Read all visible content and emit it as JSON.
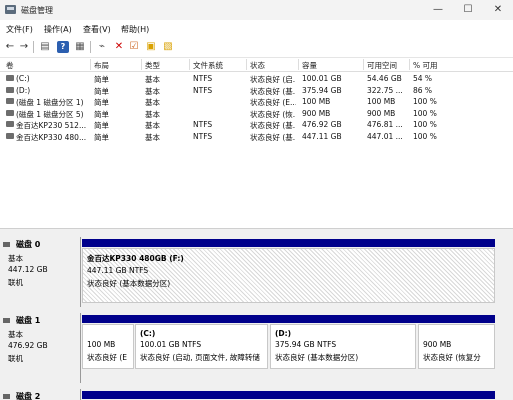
{
  "window": {
    "title": "磁盘管理",
    "min": "—",
    "max": "☐",
    "close": "✕"
  },
  "menu": [
    "文件(F)",
    "操作(A)",
    "查看(V)",
    "帮助(H)"
  ],
  "toolbar": {
    "icons": [
      "back-arrow-icon",
      "forward-arrow-icon",
      "list-view-icon",
      "help-icon",
      "properties-icon",
      "connect-icon",
      "delete-icon",
      "checkmark-icon",
      "new-icon",
      "folder-icon"
    ]
  },
  "volumes": {
    "columns": [
      "卷",
      "布局",
      "类型",
      "文件系统",
      "状态",
      "容量",
      "可用空间",
      "% 可用"
    ],
    "rows": [
      {
        "name": "(C:)",
        "layout": "简单",
        "type": "基本",
        "fs": "NTFS",
        "status": "状态良好 (启...",
        "capacity": "100.01 GB",
        "free": "54.46 GB",
        "pct": "54 %"
      },
      {
        "name": "(D:)",
        "layout": "简单",
        "type": "基本",
        "fs": "NTFS",
        "status": "状态良好 (基...",
        "capacity": "375.94 GB",
        "free": "322.75 ...",
        "pct": "86 %"
      },
      {
        "name": "(磁盘 1 磁盘分区 1)",
        "layout": "简单",
        "type": "基本",
        "fs": "",
        "status": "状态良好 (E...",
        "capacity": "100 MB",
        "free": "100 MB",
        "pct": "100 %"
      },
      {
        "name": "(磁盘 1 磁盘分区 5)",
        "layout": "简单",
        "type": "基本",
        "fs": "",
        "status": "状态良好 (恢...",
        "capacity": "900 MB",
        "free": "900 MB",
        "pct": "100 %"
      },
      {
        "name": "金百达KP230 512...",
        "layout": "简单",
        "type": "基本",
        "fs": "NTFS",
        "status": "状态良好 (基...",
        "capacity": "476.92 GB",
        "free": "476.81 ...",
        "pct": "100 %"
      },
      {
        "name": "金百达KP330 480...",
        "layout": "简单",
        "type": "基本",
        "fs": "NTFS",
        "status": "状态良好 (基...",
        "capacity": "447.11 GB",
        "free": "447.01 ...",
        "pct": "100 %"
      }
    ]
  },
  "disks": [
    {
      "name": "磁盘 0",
      "type": "基本",
      "size": "447.12 GB",
      "state": "联机",
      "parts": [
        {
          "title": "金百达KP330 480GB  (F:)",
          "size": "447.11 GB NTFS",
          "status": "状态良好 (基本数据分区)"
        }
      ]
    },
    {
      "name": "磁盘 1",
      "type": "基本",
      "size": "476.92 GB",
      "state": "联机",
      "parts": [
        {
          "title": "",
          "size": "100 MB",
          "status": "状态良好 (E"
        },
        {
          "title": "(C:)",
          "size": "100.01 GB NTFS",
          "status": "状态良好 (启动, 页面文件, 故障转储"
        },
        {
          "title": "(D:)",
          "size": "375.94 GB NTFS",
          "status": "状态良好 (基本数据分区)"
        },
        {
          "title": "",
          "size": "900 MB",
          "status": "状态良好 (恢复分"
        }
      ]
    },
    {
      "name": "磁盘 2",
      "type": "",
      "size": "",
      "state": "",
      "parts": []
    }
  ]
}
